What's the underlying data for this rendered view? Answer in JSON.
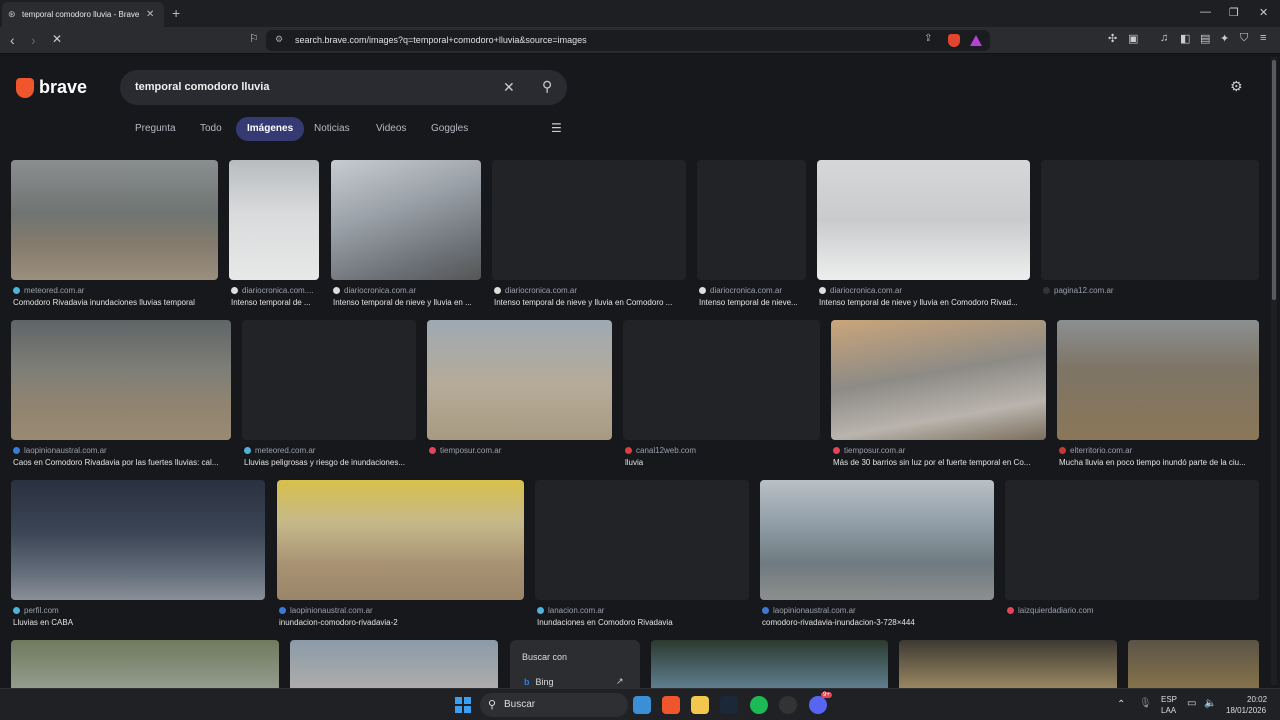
{
  "browser": {
    "tab_title": "temporal comodoro lluvia - Brave",
    "url": "search.brave.com/images?q=temporal+comodoro+lluvia&source=images"
  },
  "brand": {
    "name": "brave"
  },
  "search": {
    "query": "temporal comodoro lluvia"
  },
  "tabs": [
    {
      "label": "Pregunta",
      "active": false
    },
    {
      "label": "Todo",
      "active": false
    },
    {
      "label": "Imágenes",
      "active": true
    },
    {
      "label": "Noticias",
      "active": false
    },
    {
      "label": "Videos",
      "active": false
    },
    {
      "label": "Goggles",
      "active": false
    }
  ],
  "results": [
    {
      "source": "meteored.com.ar",
      "caption": "Comodoro Rivadavia inundaciones lluvias temporal"
    },
    {
      "source": "diariocronica.com....",
      "caption": "Intenso temporal de ..."
    },
    {
      "source": "diariocronica.com.ar",
      "caption": "Intenso temporal de nieve y lluvia en ..."
    },
    {
      "source": "diariocronica.com.ar",
      "caption": "Intenso temporal de nieve y lluvia en Comodoro ..."
    },
    {
      "source": "diariocronica.com.ar",
      "caption": "Intenso temporal de nieve..."
    },
    {
      "source": "diariocronica.com.ar",
      "caption": "Intenso temporal de nieve y lluvia en Comodoro Rivad..."
    },
    {
      "source": "pagina12.com.ar",
      "caption": ""
    },
    {
      "source": "laopinionaustral.com.ar",
      "caption": "Caos en Comodoro Rivadavia por las fuertes lluvias: cal..."
    },
    {
      "source": "meteored.com.ar",
      "caption": "Lluvias peligrosas y riesgo de inundaciones..."
    },
    {
      "source": "tiemposur.com.ar",
      "caption": ""
    },
    {
      "source": "canal12web.com",
      "caption": "lluvia"
    },
    {
      "source": "tiemposur.com.ar",
      "caption": "Más de 30 barrios sin luz por el fuerte temporal en Co..."
    },
    {
      "source": "elterritorio.com.ar",
      "caption": "Mucha lluvia en poco tiempo inundó parte de la ciu..."
    },
    {
      "source": "perfil.com",
      "caption": "Lluvias en CABA"
    },
    {
      "source": "laopinionaustral.com.ar",
      "caption": "inundacion-comodoro-rivadavia-2"
    },
    {
      "source": "lanacion.com.ar",
      "caption": "Inundaciones en Comodoro Rivadavia"
    },
    {
      "source": "laopinionaustral.com.ar",
      "caption": "comodoro-rivadavia-inundacion-3-728×444"
    },
    {
      "source": "laizquierdadiario.com",
      "caption": ""
    }
  ],
  "popup": {
    "title": "Buscar con",
    "engine": "Bing"
  },
  "taskbar": {
    "search_label": "Buscar",
    "lang": "ESP",
    "layout": "LAA",
    "time": "20:02",
    "date": "18/01/2026",
    "discord_badge": "9+"
  }
}
